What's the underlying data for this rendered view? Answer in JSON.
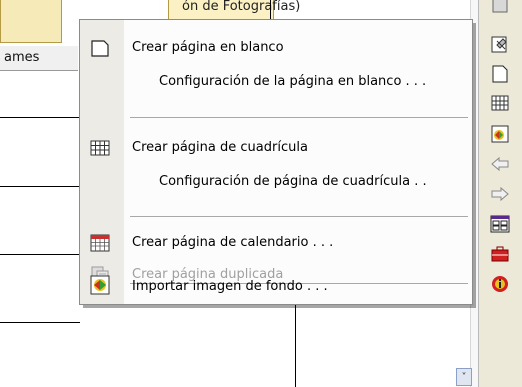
{
  "background": {
    "title_fragment": "ón de Fotografías)",
    "names_header": "ames"
  },
  "menu": {
    "items": [
      {
        "label": "Crear página en blanco",
        "icon": "blank-page-icon",
        "disabled": false
      },
      {
        "label": "Configuración de la página en blanco . . .",
        "icon": "",
        "disabled": false
      },
      {
        "label": "Crear página de cuadrícula",
        "icon": "grid-page-icon",
        "disabled": false
      },
      {
        "label": "Configuración de página de cuadrícula . .",
        "icon": "",
        "disabled": false
      },
      {
        "label": "Crear página de calendario . . .",
        "icon": "calendar-page-icon",
        "disabled": false
      },
      {
        "label": "Crear página duplicada",
        "icon": "duplicate-page-icon",
        "disabled": true
      },
      {
        "label": "Importar imagen de fondo . . .",
        "icon": "import-background-icon",
        "disabled": false
      }
    ]
  },
  "toolbar": {
    "icons": [
      "tools-icon",
      "blank-page-icon",
      "grid-page-icon",
      "background-image-icon",
      "arrow-left-icon",
      "arrow-right-icon",
      "calendar-grid-icon",
      "briefcase-icon",
      "info-icon"
    ]
  },
  "scroll": {
    "down_glyph": "˅"
  }
}
